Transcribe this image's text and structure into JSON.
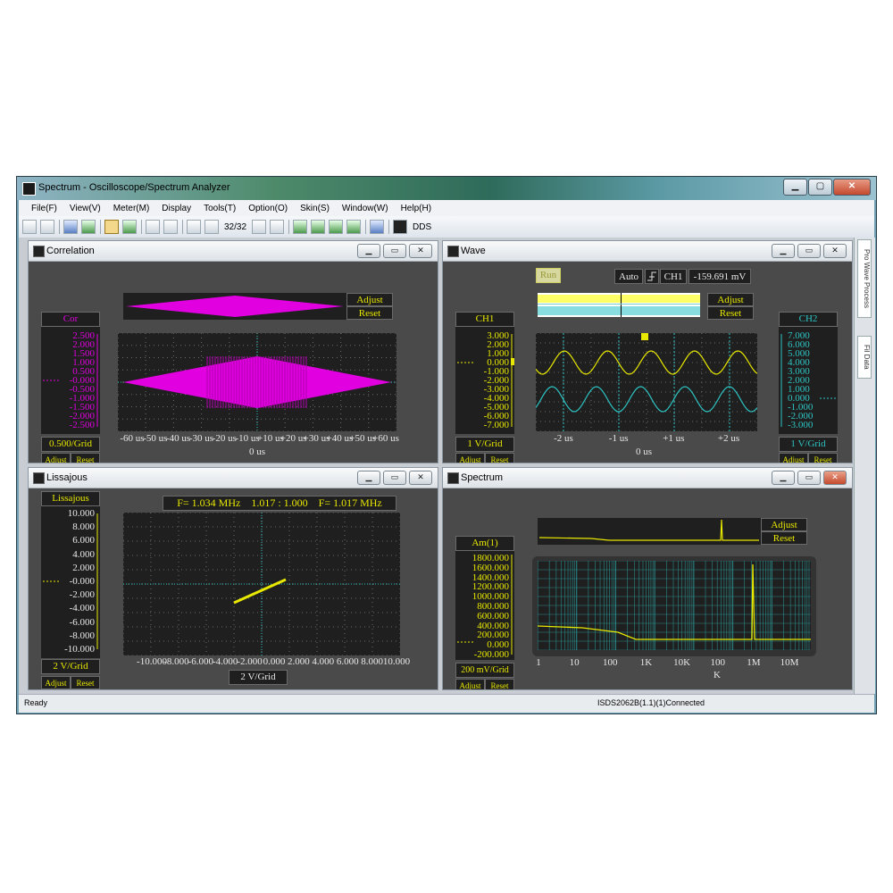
{
  "window": {
    "title": "Spectrum - Oscilloscope/Spectrum Analyzer",
    "minimize": "▁",
    "maximize": "▢",
    "close": "✕"
  },
  "menu": [
    "File(F)",
    "View(V)",
    "Meter(M)",
    "Display",
    "Tools(T)",
    "Option(O)",
    "Skin(S)",
    "Window(W)",
    "Help(H)"
  ],
  "toolbar": {
    "frame_counter": "32/32",
    "dds_label": "DDS"
  },
  "side_tabs": [
    "Pro Wave Process",
    "Fil Data"
  ],
  "status": {
    "left": "Ready",
    "right": "ISDS2062B(1.1)(1)Connected"
  },
  "child_buttons": {
    "minimize": "▁",
    "restore": "▭",
    "close": "✕"
  },
  "correlation": {
    "title": "Correlation",
    "label": "Cor",
    "adjust": "Adjust",
    "reset": "Reset",
    "y_ticks": [
      "2.500",
      "2.000",
      "1.500",
      "1.000",
      "0.500",
      "-0.000",
      "-0.500",
      "-1.000",
      "-1.500",
      "-2.000",
      "-2.500"
    ],
    "x_ticks": [
      "-60 us",
      "-50 us",
      "-40 us",
      "-30 us",
      "-20 us",
      "-10 us",
      "+10 us",
      "+20 us",
      "+30 us",
      "+40 us",
      "+50 us",
      "+60 us"
    ],
    "x_center": "0 us",
    "scale": "0.500/Grid",
    "bottom_adjust": "Adjust",
    "bottom_reset": "Reset"
  },
  "wave": {
    "title": "Wave",
    "run": "Run",
    "mode": "Auto",
    "trigger_icon": "trigger-rising-icon",
    "trigger_channel": "CH1",
    "trigger_level": "-159.691 mV",
    "adjust": "Adjust",
    "reset": "Reset",
    "ch1_label": "CH1",
    "ch2_label": "CH2",
    "ch1_ticks": [
      "3.000",
      "2.000",
      "1.000",
      "0.000",
      "-1.000",
      "-2.000",
      "-3.000",
      "-4.000",
      "-5.000",
      "-6.000",
      "-7.000"
    ],
    "ch2_ticks": [
      "7.000",
      "6.000",
      "5.000",
      "4.000",
      "3.000",
      "2.000",
      "1.000",
      "0.000",
      "-1.000",
      "-2.000",
      "-3.000"
    ],
    "x_ticks": [
      "-2 us",
      "-1 us",
      "+1 us",
      "+2 us"
    ],
    "x_center": "0 us",
    "ch1_scale": "1 V/Grid",
    "ch2_scale": "1 V/Grid",
    "bottom_adjust": "Adjust",
    "bottom_reset": "Reset"
  },
  "lissajous": {
    "title": "Lissajous",
    "label": "Lissajous",
    "info": "F= 1.034 MHz    1.017 : 1.000    F= 1.017 MHz",
    "y_ticks": [
      "10.000",
      "8.000",
      "6.000",
      "4.000",
      "2.000",
      "-0.000",
      "-2.000",
      "-4.000",
      "-6.000",
      "-8.000",
      "-10.000"
    ],
    "x_ticks": [
      "-10.000",
      "-8.000",
      "-6.000",
      "-4.000",
      "-2.000",
      "0.000",
      "2.000",
      "4.000",
      "6.000",
      "8.000",
      "10.000"
    ],
    "y_scale": "2 V/Grid",
    "x_scale": "2 V/Grid",
    "bottom_adjust": "Adjust",
    "bottom_reset": "Reset"
  },
  "spectrum": {
    "title": "Spectrum",
    "label": "Am(1)",
    "adjust": "Adjust",
    "reset": "Reset",
    "y_ticks": [
      "1800.000",
      "1600.000",
      "1400.000",
      "1200.000",
      "1000.000",
      "800.000",
      "600.000",
      "400.000",
      "200.000",
      "0.000",
      "-200.000"
    ],
    "x_ticks": [
      "1",
      "10",
      "100",
      "1K",
      "10K",
      "100",
      "1M",
      "10M"
    ],
    "x_unit": "K",
    "scale": "200 mV/Grid",
    "bottom_adjust": "Adjust",
    "bottom_reset": "Reset"
  },
  "colors": {
    "yellow": "#e8e800",
    "magenta": "#e000e0",
    "cyan": "#2ec4c4",
    "panel": "#4a4a4a",
    "plot_bg": "#1f1f1f"
  }
}
